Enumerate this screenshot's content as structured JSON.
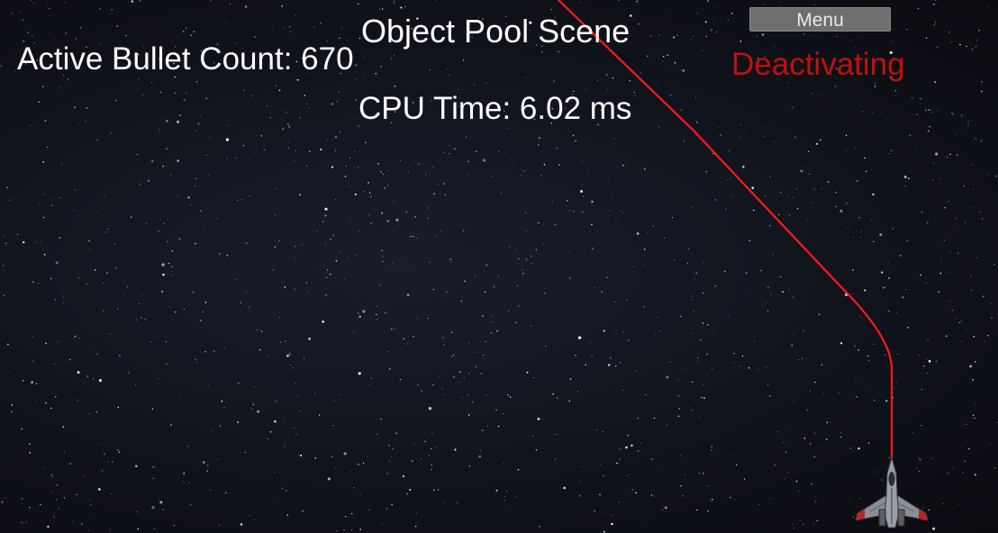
{
  "hud": {
    "scene_title": "Object Pool Scene",
    "bullet_count_label": "Active Bullet Count: 670",
    "cpu_time_label": "CPU Time: 6.02 ms",
    "status_text": "Deactivating"
  },
  "menu": {
    "button_label": "Menu"
  },
  "colors": {
    "hud_text": "#ffffff",
    "status_text": "#c0100f",
    "bullet_trail": "#ff1a1a",
    "menu_button": "#6e6e6e"
  },
  "player": {
    "icon": "spaceship-icon"
  }
}
